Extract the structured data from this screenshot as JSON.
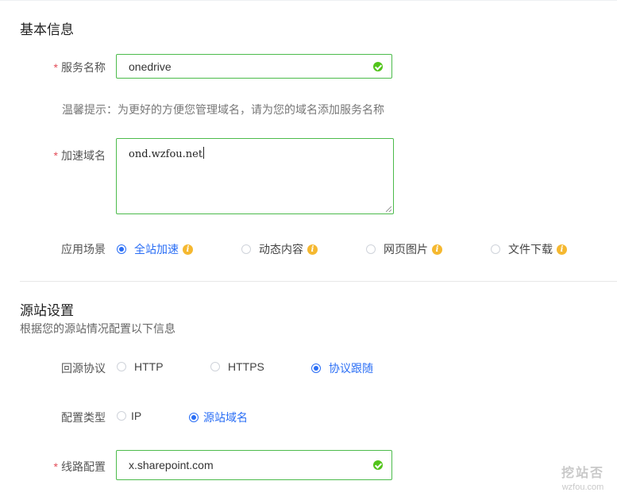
{
  "basic": {
    "title": "基本信息",
    "service_name": {
      "label": "服务名称",
      "value": "onedrive",
      "valid": true
    },
    "hint": "温馨提示：为更好的方便您管理域名，请为您的域名添加服务名称",
    "domain": {
      "label": "加速域名",
      "value": "ond.wzfou.net"
    },
    "scene": {
      "label": "应用场景",
      "options": [
        "全站加速",
        "动态内容",
        "网页图片",
        "文件下载"
      ],
      "selected": "全站加速"
    }
  },
  "origin": {
    "title": "源站设置",
    "desc": "根据您的源站情况配置以下信息",
    "protocol": {
      "label": "回源协议",
      "options": [
        "HTTP",
        "HTTPS",
        "协议跟随"
      ],
      "selected": "协议跟随"
    },
    "config_type": {
      "label": "配置类型",
      "options": [
        "IP",
        "源站域名"
      ],
      "selected": "源站域名"
    },
    "route": {
      "label": "线路配置",
      "value": "x.sharepoint.com",
      "valid": true
    }
  },
  "watermark": {
    "cn": "挖站否",
    "en": "wzfou.com"
  },
  "colors": {
    "accent": "#2a6ef5",
    "valid": "#4cbb4b",
    "required": "#e34d59",
    "info": "#f5b830"
  },
  "icons": {
    "valid": "check-circle-icon",
    "info": "info-circle-icon"
  }
}
